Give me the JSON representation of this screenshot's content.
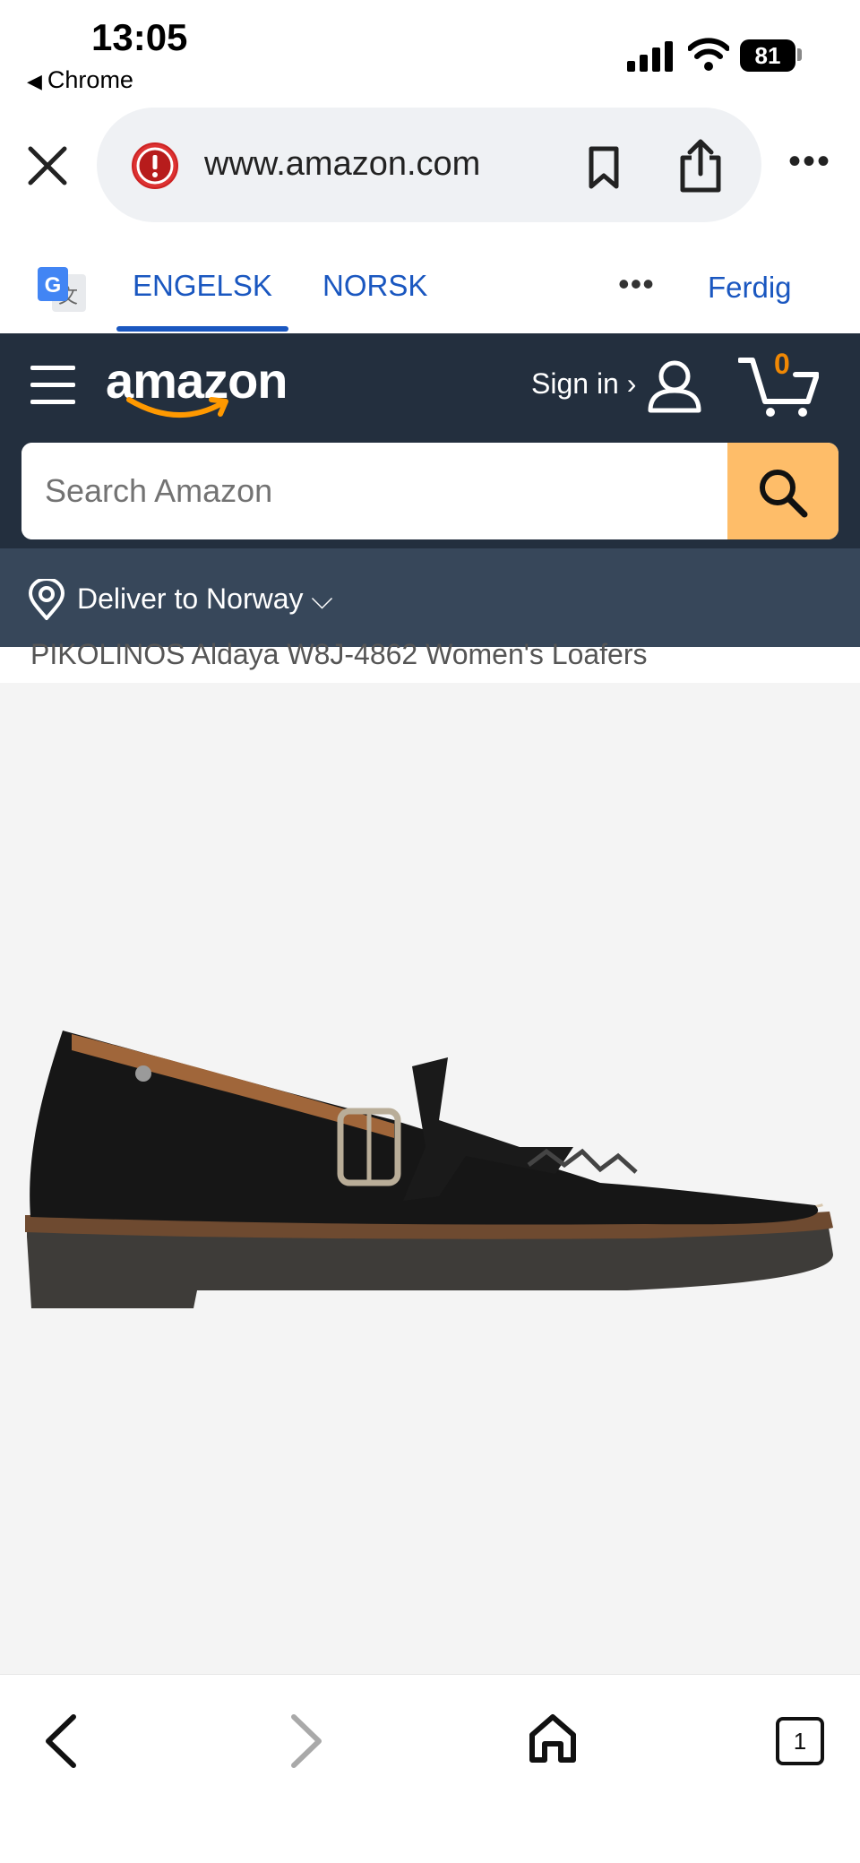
{
  "status_bar": {
    "time": "13:05",
    "back_app_label": "Chrome",
    "battery": "81"
  },
  "browser": {
    "url": "www.amazon.com",
    "icons": [
      "close-icon",
      "warning-icon",
      "bookmark-icon",
      "share-icon",
      "more-icon"
    ]
  },
  "translate_bar": {
    "tab_source": "ENGELSK",
    "tab_target": "NORSK",
    "done_label": "Ferdig",
    "selected_tab": "ENGELSK",
    "accent_color": "#1a57c0"
  },
  "amazon": {
    "logo_text": "amazon",
    "sign_in_label": "Sign in ›",
    "cart_count": "0",
    "search_placeholder": "Search Amazon",
    "deliver_label": "Deliver to Norway ⌵",
    "header_color": "#232f3e",
    "search_button_color": "#febd69"
  },
  "product": {
    "title": "PIKOLINOS Aldaya W8J-4862 Women's Loafers"
  },
  "toolbar": {
    "tab_count": "1"
  }
}
